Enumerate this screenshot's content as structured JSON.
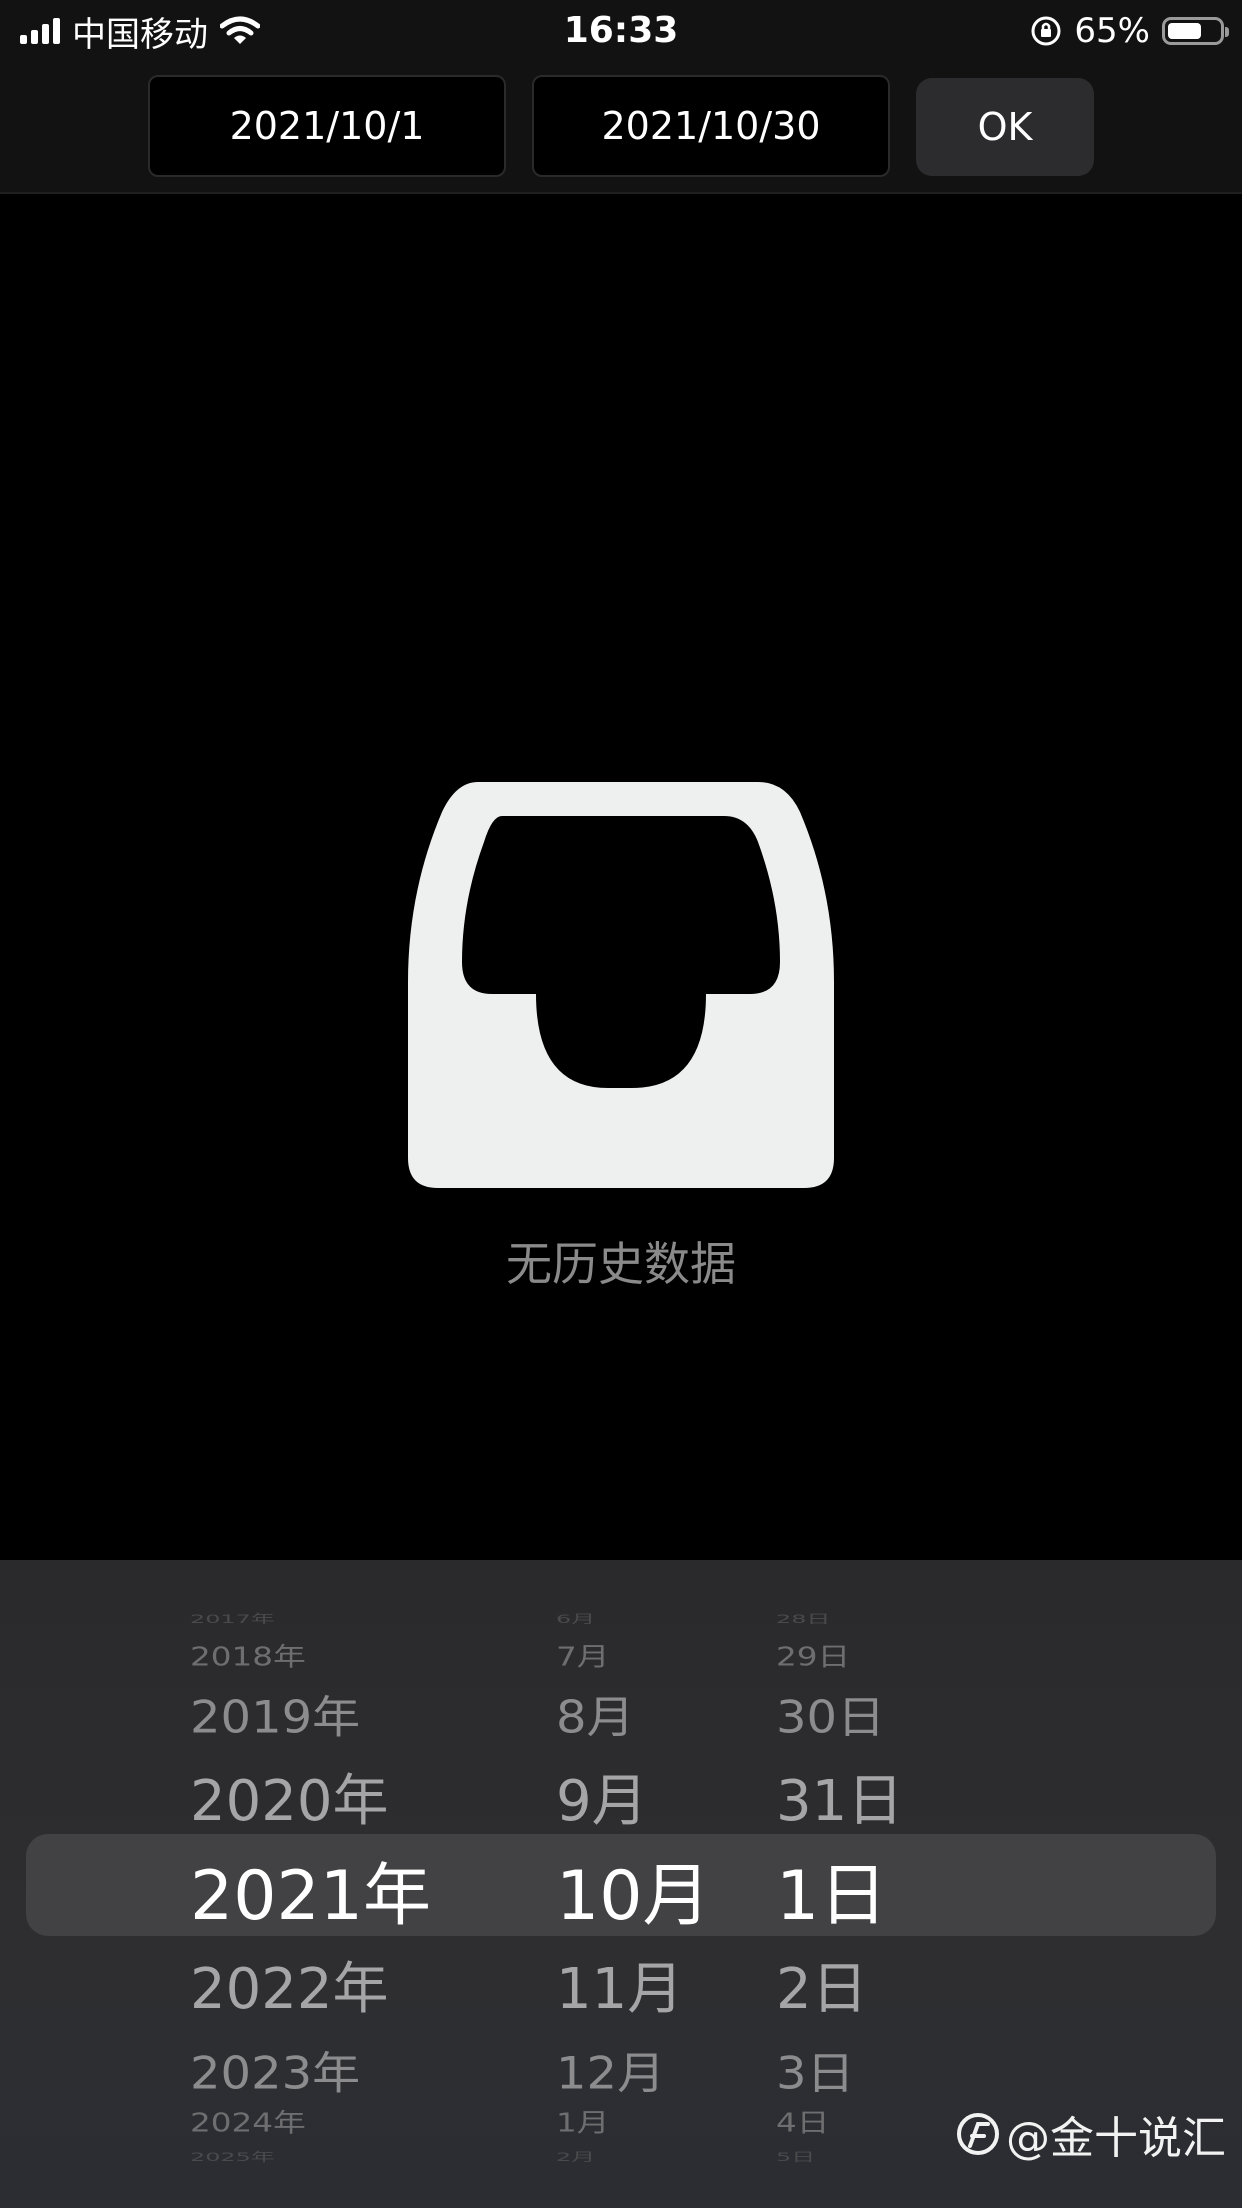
{
  "status_bar": {
    "carrier": "中国移动",
    "time": "16:33",
    "battery_percent": "65%",
    "battery_level": 0.65,
    "icons": [
      "signal-icon",
      "wifi-icon",
      "rotation-lock-icon",
      "battery-icon"
    ]
  },
  "header": {
    "start_date": "2021/10/1",
    "end_date": "2021/10/30",
    "ok_label": "OK"
  },
  "empty_state": {
    "icon": "inbox-tray-icon",
    "message": "无历史数据"
  },
  "picker": {
    "years": [
      "2017年",
      "2018年",
      "2019年",
      "2020年",
      "2021年",
      "2022年",
      "2023年",
      "2024年",
      "2025年"
    ],
    "months": [
      "6月",
      "7月",
      "8月",
      "9月",
      "10月",
      "11月",
      "12月",
      "1月",
      "2月"
    ],
    "days": [
      "28日",
      "29日",
      "30日",
      "31日",
      "1日",
      "2日",
      "3日",
      "4日",
      "5日"
    ],
    "selected_year": "2021年",
    "selected_month": "10月",
    "selected_day": "1日"
  },
  "watermark": {
    "text": "@金十说汇"
  }
}
